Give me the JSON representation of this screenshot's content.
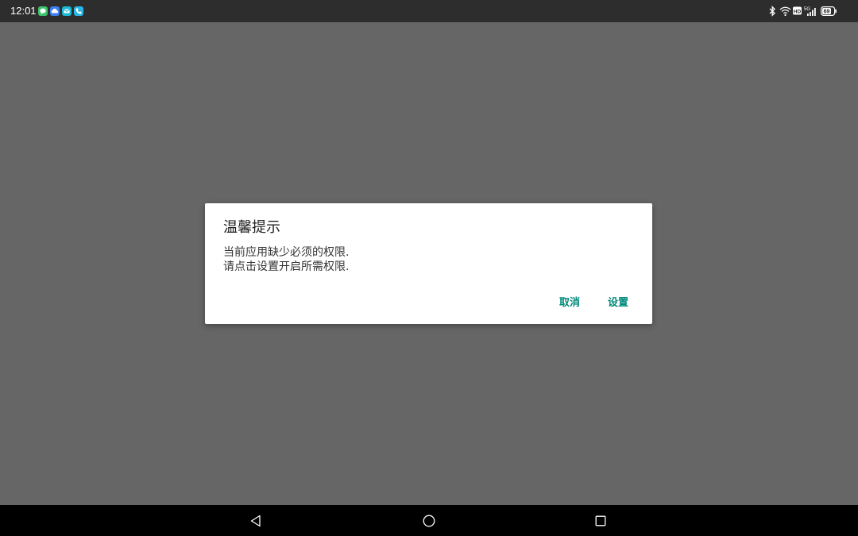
{
  "status_bar": {
    "time": "12:01",
    "notification_icons": [
      {
        "name": "chat-app-icon",
        "color": "#3dc46a"
      },
      {
        "name": "cloud-app-icon",
        "color": "#3d7df2"
      },
      {
        "name": "mail-app-icon",
        "color": "#19b9d6"
      },
      {
        "name": "phone-app-icon",
        "color": "#29b6e6"
      }
    ],
    "system_icons": [
      "bluetooth-icon",
      "wifi-icon",
      "hd-icon",
      "signal-5g-icon",
      "battery-icon"
    ],
    "hd_label": "HD",
    "network_label": "5G",
    "battery_level": "69"
  },
  "dialog": {
    "title": "温馨提示",
    "message_line1": "当前应用缺少必须的权限.",
    "message_line2": "请点击设置开启所需权限.",
    "cancel_label": "取消",
    "settings_label": "设置",
    "accent_color": "#00897b"
  },
  "nav_bar": {
    "buttons": [
      "back-icon",
      "home-icon",
      "recents-icon"
    ]
  }
}
